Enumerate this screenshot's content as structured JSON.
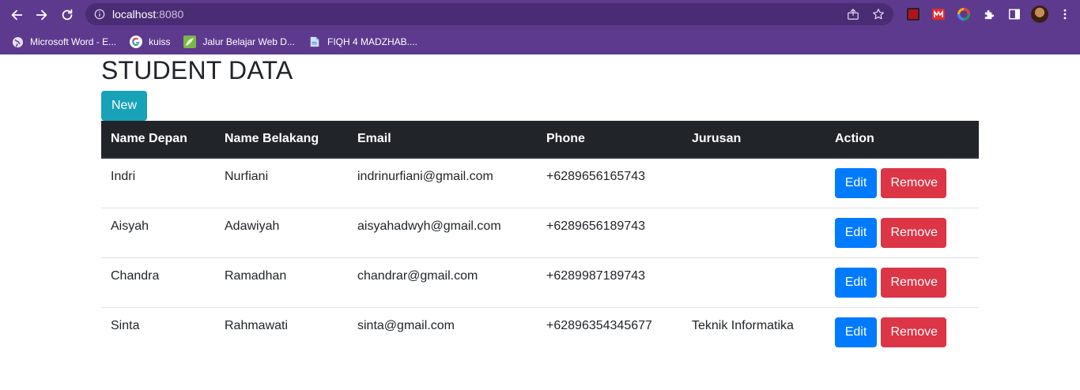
{
  "browser": {
    "url_host": "localhost",
    "url_port": ":8080",
    "bookmarks": [
      {
        "label": "Microsoft Word - E...",
        "icon": "globe-icon"
      },
      {
        "label": "kuiss",
        "icon": "google-icon"
      },
      {
        "label": "Jalur Belajar Web D...",
        "icon": "leaf-icon"
      },
      {
        "label": "FIQH 4 MADZHAB....",
        "icon": "document-icon"
      }
    ]
  },
  "page": {
    "title": "STUDENT DATA",
    "new_label": "New"
  },
  "table": {
    "headers": [
      "Name Depan",
      "Name Belakang",
      "Email",
      "Phone",
      "Jurusan",
      "Action"
    ],
    "rows": [
      {
        "first": "Indri",
        "last": "Nurfiani",
        "email": "indrinurfiani@gmail.com",
        "phone": "+6289656165743",
        "jurusan": ""
      },
      {
        "first": "Aisyah",
        "last": "Adawiyah",
        "email": "aisyahadwyh@gmail.com",
        "phone": "+6289656189743",
        "jurusan": ""
      },
      {
        "first": "Chandra",
        "last": "Ramadhan",
        "email": "chandrar@gmail.com",
        "phone": "+6289987189743",
        "jurusan": ""
      },
      {
        "first": "Sinta",
        "last": "Rahmawati",
        "email": "sinta@gmail.com",
        "phone": "+62896354345677",
        "jurusan": "Teknik Informatika"
      }
    ],
    "edit_label": "Edit",
    "remove_label": "Remove"
  },
  "colors": {
    "chrome": "#5e3a8e",
    "new_button": "#17a2b8",
    "edit_button": "#007bff",
    "remove_button": "#dc3545",
    "table_header": "#212529"
  }
}
